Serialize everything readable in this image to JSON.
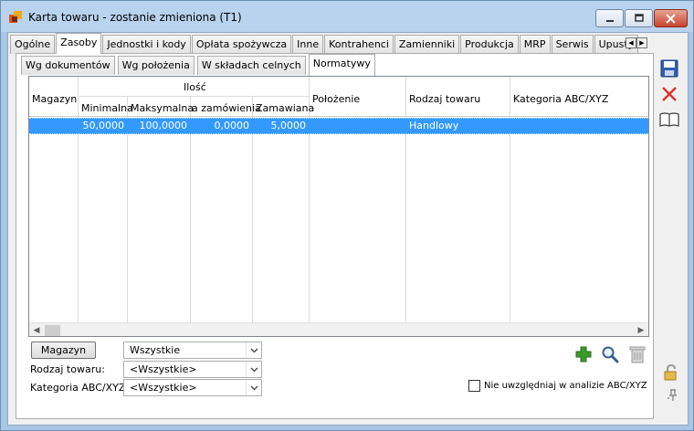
{
  "window": {
    "title": "Karta towaru - zostanie zmieniona (T1)"
  },
  "tabs": [
    {
      "label": "Ogólne"
    },
    {
      "label": "Zasoby"
    },
    {
      "label": "Jednostki i kody"
    },
    {
      "label": "Opłata spożywcza"
    },
    {
      "label": "Inne"
    },
    {
      "label": "Kontrahenci"
    },
    {
      "label": "Zamienniki"
    },
    {
      "label": "Produkcja"
    },
    {
      "label": "MRP"
    },
    {
      "label": "Serwis"
    },
    {
      "label": "Upusty"
    }
  ],
  "subtabs": [
    {
      "label": "Wg dokumentów"
    },
    {
      "label": "Wg położenia"
    },
    {
      "label": "W składach celnych"
    },
    {
      "label": "Normatywy"
    }
  ],
  "grid": {
    "headers": {
      "magazyn": "Magazyn",
      "ilosc": "Ilość",
      "minimalna": "Minimalna",
      "maksymalna": "Maksymalna",
      "zamowienia": "a zamówienia",
      "zamawiana": "Zamawiana",
      "polozenie": "Położenie",
      "rodzaj": "Rodzaj towaru",
      "kategoria": "Kategoria ABC/XYZ"
    },
    "rows": [
      {
        "magazyn": "",
        "minimalna": "50,0000",
        "maksymalna": "100,0000",
        "zamowienia": "0,0000",
        "zamawiana": "5,0000",
        "polozenie": "",
        "rodzaj": "Handlowy",
        "kategoria": ""
      }
    ]
  },
  "filters": {
    "magazyn_button": "Magazyn",
    "magazyn_value": "Wszystkie",
    "rodzaj_label": "Rodzaj towaru:",
    "rodzaj_value": "<Wszystkie>",
    "kategoria_label": "Kategoria ABC/XYZ:",
    "kategoria_value": "<Wszystkie>",
    "exclude_label": "Nie uwzględniaj w analizie ABC/XYZ",
    "exclude_checked": false
  },
  "colors": {
    "selection": "#3399ff",
    "add_icon": "#3c9a2a",
    "close_icon": "#d9342a",
    "save_icon": "#2f5fb0"
  }
}
